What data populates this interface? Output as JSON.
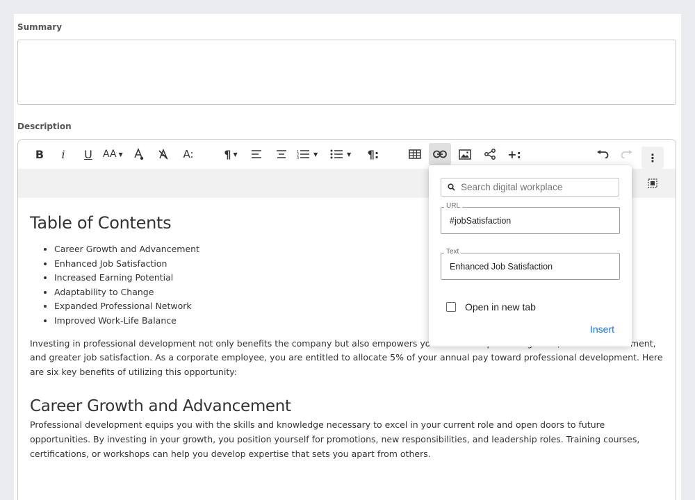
{
  "summary": {
    "label": "Summary",
    "value": ""
  },
  "description": {
    "label": "Description"
  },
  "toolbar": {
    "bold": "B",
    "italic": "i",
    "underline": "U",
    "font_size": "AA",
    "text_style": "A:",
    "paragraph": "¶",
    "paragraph_format": "¶:",
    "more": "⋮",
    "insert_more": "+:"
  },
  "content": {
    "toc_title": "Table of Contents",
    "toc_items": [
      "Career Growth and Advancement",
      "Enhanced Job Satisfaction",
      "Increased Earning Potential",
      "Adaptability to Change",
      "Expanded Professional Network",
      "Improved Work-Life Balance"
    ],
    "intro": "Investing in professional development not only benefits the company but also empowers you to achieve personal growth, career advancement, and greater job satisfaction. As a corporate employee, you are entitled to allocate 5% of your annual pay toward professional development. Here are six key benefits of utilizing this opportunity:",
    "section1_title": "Career Growth and Advancement",
    "section1_body": "Professional development equips you with the skills and knowledge necessary to excel in your current role and open doors to future opportunities. By investing in your growth, you position yourself for promotions, new responsibilities, and leadership roles. Training courses, certifications, or workshops can help you develop expertise that sets you apart from others."
  },
  "link_popup": {
    "search_placeholder": "Search digital workplace",
    "url_label": "URL",
    "url_value": "#jobSatisfaction",
    "text_label": "Text",
    "text_value": "Enhanced Job Satisfaction",
    "open_new_tab_label": "Open in new tab",
    "open_new_tab_checked": false,
    "insert_label": "Insert"
  },
  "colors": {
    "link_accent": "#1a73e8",
    "page_bg": "#ebecf0"
  }
}
